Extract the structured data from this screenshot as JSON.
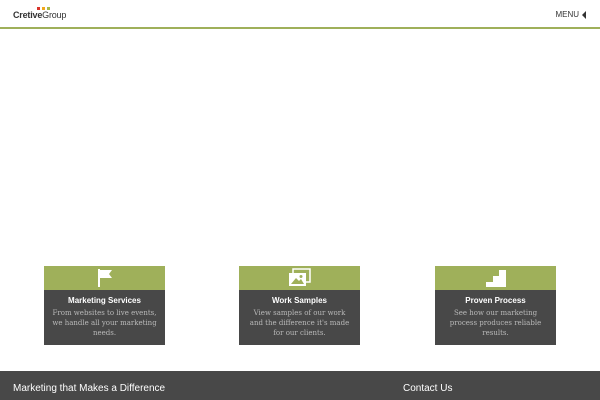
{
  "header": {
    "logo": {
      "part1": "Cre",
      "part2": "tive",
      "part3": "Group",
      "dot_colors": [
        "#d9342b",
        "#f2a71b",
        "#a8b94b"
      ]
    },
    "menu_label": "MENU"
  },
  "cards": [
    {
      "icon": "flag-icon",
      "title": "Marketing Services",
      "desc_lines": [
        "From websites to live events,",
        "we handle all your marketing",
        "needs."
      ]
    },
    {
      "icon": "image-gallery-icon",
      "title": "Work Samples",
      "desc_lines": [
        "View samples of our work",
        "and the difference it's made",
        "for our clients."
      ]
    },
    {
      "icon": "steps-icon",
      "title": "Proven Process",
      "desc_lines": [
        "See how our marketing",
        "process produces reliable",
        "results."
      ]
    }
  ],
  "footer": {
    "left_text": "Marketing that Makes a Difference",
    "right_text": "Contact Us"
  },
  "colors": {
    "accent": "#9fb05a",
    "dark": "#484848"
  }
}
